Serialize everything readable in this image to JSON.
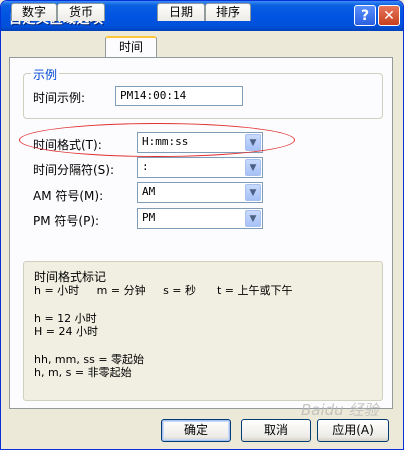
{
  "window": {
    "title": "自定义区域选项"
  },
  "titlebar": {
    "help": "?",
    "close": "✕"
  },
  "tabs": [
    "数字",
    "货币",
    "时间",
    "日期",
    "排序"
  ],
  "example": {
    "legend": "示例",
    "label": "时间示例:",
    "value": "PM14:00:14"
  },
  "settings": {
    "format_label": "时间格式(T):",
    "format_value": "H:mm:ss",
    "separator_label": "时间分隔符(S):",
    "separator_value": ":",
    "am_label": "AM 符号(M):",
    "am_value": "AM",
    "pm_label": "PM 符号(P):",
    "pm_value": "PM"
  },
  "notation": {
    "title": "时间格式标记",
    "line1": "h = 小时     m = 分钟     s = 秒      t = 上午或下午",
    "line2": "h = 12 小时",
    "line3": "H = 24 小时",
    "line4": "hh, mm, ss = 零起始",
    "line5": "h, m, s = 非零起始"
  },
  "buttons": {
    "ok": "确定",
    "cancel": "取消",
    "apply": "应用(A)"
  },
  "watermark": "Baidu 经验"
}
